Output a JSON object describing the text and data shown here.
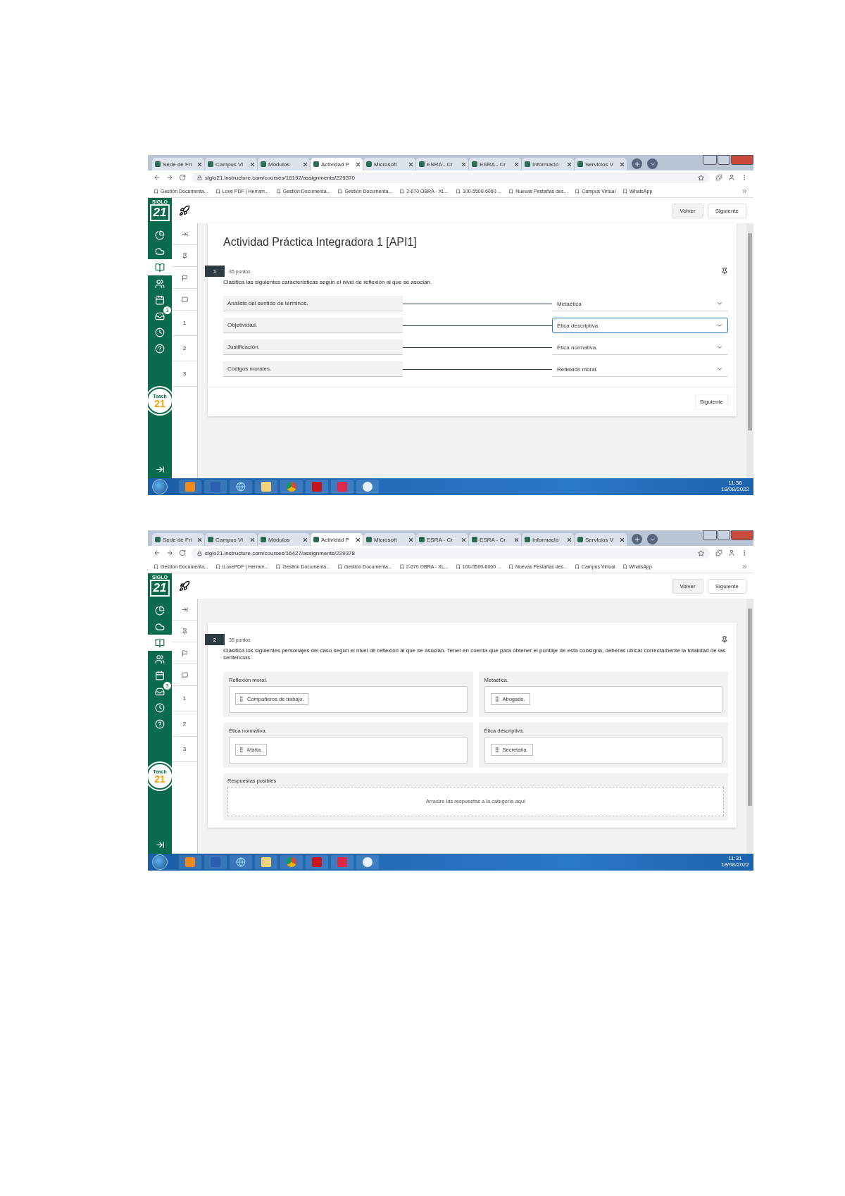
{
  "screenshots": [
    {
      "tabs": [
        {
          "label": "Sede de Fri",
          "selected": false
        },
        {
          "label": "Campus Vi",
          "selected": false
        },
        {
          "label": "Módulos",
          "selected": false
        },
        {
          "label": "Actividad P",
          "selected": true
        },
        {
          "label": "Microsoft",
          "selected": false
        },
        {
          "label": "ESRA - Cr",
          "selected": false
        },
        {
          "label": "ESRA - Cr",
          "selected": false
        },
        {
          "label": "Informació",
          "selected": false
        },
        {
          "label": "Servicios V",
          "selected": false
        }
      ],
      "url": "siglo21.instructure.com/courses/16192/assignments/229370",
      "bookmarks": [
        "Gestión Documenta...",
        "Love PDF | Herram...",
        "Gestión Documenta...",
        "Gestión Documenta...",
        "2-670 OBRA - XL...",
        "100-5500-6060 ...",
        "Nuevas Pestañas des...",
        "Campus Virtual",
        "WhatsApp"
      ],
      "logo": {
        "top": "SIGLO",
        "mark": "21"
      },
      "rail": [
        {
          "kind": "dashboard",
          "selected": false
        },
        {
          "kind": "cloud",
          "selected": false
        },
        {
          "kind": "courses",
          "selected": true
        },
        {
          "kind": "people",
          "selected": false
        },
        {
          "kind": "calendar",
          "selected": false
        },
        {
          "kind": "inbox",
          "selected": false,
          "badge": "3"
        },
        {
          "kind": "history",
          "selected": false
        },
        {
          "kind": "help",
          "selected": false
        }
      ],
      "teach_badge": {
        "word": "Teach",
        "number": "21"
      },
      "header_buttons": [
        "Volver",
        "Siguiente"
      ],
      "question_numbers": [
        "1",
        "2",
        "3"
      ],
      "question": {
        "kind": "matching",
        "page_title": "Actividad Práctica Integradora 1 [API1]",
        "number": "1",
        "points": "35 puntos",
        "prompt": "Clasifica las siguientes características según el nivel de reflexión al que se asocian.",
        "pairs": [
          {
            "term": "Análisis del sentido de términos.",
            "answer": "Metaética",
            "focused": false
          },
          {
            "term": "Objetividad.",
            "answer": "Ética descriptiva",
            "focused": true
          },
          {
            "term": "Justificación.",
            "answer": "Ética normativa.",
            "focused": false
          },
          {
            "term": "Códigos morales.",
            "answer": "Reflexión moral.",
            "focused": false
          }
        ],
        "next_button": "Siguiente"
      },
      "taskbar": {
        "time": "11:36",
        "date": "18/08/2022"
      }
    },
    {
      "tabs": [
        {
          "label": "Sede de Fri",
          "selected": false
        },
        {
          "label": "Campus Vi",
          "selected": false
        },
        {
          "label": "Módulos",
          "selected": false
        },
        {
          "label": "Actividad P",
          "selected": true
        },
        {
          "label": "Microsoft",
          "selected": false
        },
        {
          "label": "ESRA - Cr",
          "selected": false
        },
        {
          "label": "ESRA - Cr",
          "selected": false
        },
        {
          "label": "Informació",
          "selected": false
        },
        {
          "label": "Servicios V",
          "selected": false
        }
      ],
      "url": "siglo21.instructure.com/courses/16427/assignments/229378",
      "bookmarks": [
        "Gestión Documenta...",
        "iLovePDF | Herram...",
        "Gestión Documenta...",
        "Gestión Documenta...",
        "2-670 OBRA - XL...",
        "100-5500-6060 ...",
        "Nuevas Pestañas des...",
        "Campus Virtual",
        "WhatsApp"
      ],
      "logo": {
        "top": "SIGLO",
        "mark": "21"
      },
      "rail": [
        {
          "kind": "dashboard",
          "selected": false
        },
        {
          "kind": "cloud",
          "selected": false
        },
        {
          "kind": "courses",
          "selected": true
        },
        {
          "kind": "people",
          "selected": false
        },
        {
          "kind": "calendar",
          "selected": false
        },
        {
          "kind": "inbox",
          "selected": false,
          "badge": "3"
        },
        {
          "kind": "history",
          "selected": false
        },
        {
          "kind": "help",
          "selected": false
        }
      ],
      "teach_badge": {
        "word": "Teach",
        "number": "21"
      },
      "header_buttons": [
        "Volver",
        "Siguiente"
      ],
      "question_numbers": [
        "1",
        "2",
        "3"
      ],
      "question": {
        "kind": "categorize",
        "number": "2",
        "points": "35 puntos",
        "prompt": "Clasifica los siguientes personajes del caso según el nivel de reflexión al que se asocian. Tener en cuenta que para obtener el puntaje de esta consigna, deberás ubicar correctamente la totalidad de las sentencias.",
        "categories": [
          {
            "label": "Reflexión moral.",
            "items": [
              "Compañeros de trabajo."
            ]
          },
          {
            "label": "Metaética.",
            "items": [
              "Abogado."
            ]
          },
          {
            "label": "Ética normativa.",
            "items": [
              "Marta."
            ]
          },
          {
            "label": "Ética descriptiva.",
            "items": [
              "Secretaria."
            ]
          }
        ],
        "pool_label": "Respuestas posibles",
        "pool_hint": "Arrastre las respuestas a la categoría aquí"
      },
      "taskbar": {
        "time": "11:31",
        "date": "18/08/2022"
      }
    }
  ]
}
